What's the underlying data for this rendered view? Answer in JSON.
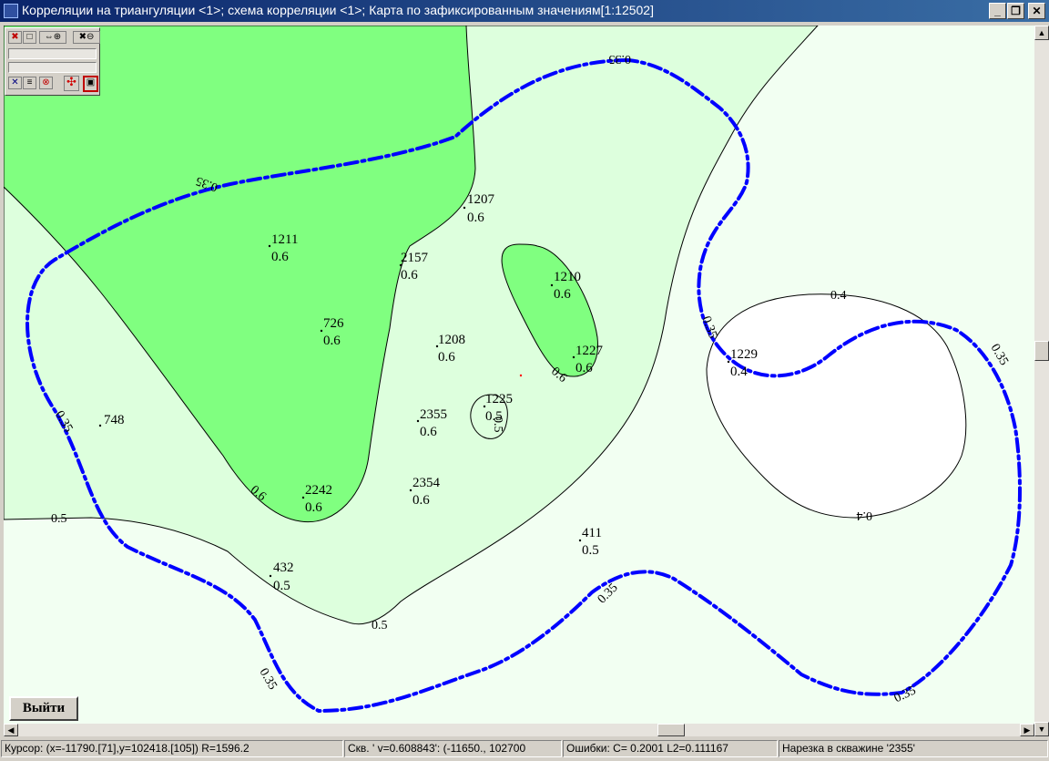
{
  "window": {
    "title": "Корреляции на триангуляции <1>; схема корреляции <1>; Карта по зафиксированным значениям[1:12502]",
    "buttons": {
      "minimize": "_",
      "restore": "❐",
      "close": "✕"
    }
  },
  "toolbox": {
    "row1": [
      "delete-icon",
      "square-icon",
      "move-zoom-icon",
      "zoom-out-icon"
    ],
    "row2": [
      "cross-icon",
      "list-icon",
      "stop-icon",
      "navigate-icon",
      "map-icon"
    ]
  },
  "map": {
    "colors": {
      "zone06": "#80ff80",
      "zone05": "#ddffdd",
      "zone04": "#ffffff",
      "background": "#f2fff2",
      "isoline": "#0000ff"
    },
    "wells": [
      {
        "id": "1207",
        "value": "0.6"
      },
      {
        "id": "1211",
        "value": "0.6"
      },
      {
        "id": "2157",
        "value": "0.6"
      },
      {
        "id": "1210",
        "value": "0.6"
      },
      {
        "id": "726",
        "value": "0.6"
      },
      {
        "id": "1208",
        "value": "0.6"
      },
      {
        "id": "1227",
        "value": "0.6"
      },
      {
        "id": "1229",
        "value": "0.4"
      },
      {
        "id": "1225",
        "value": "0.5"
      },
      {
        "id": "748",
        "value": ""
      },
      {
        "id": "2355",
        "value": "0.6"
      },
      {
        "id": "2242",
        "value": "0.6"
      },
      {
        "id": "2354",
        "value": "0.6"
      },
      {
        "id": "411",
        "value": "0.5"
      },
      {
        "id": "432",
        "value": "0.5"
      }
    ],
    "contour_labels": [
      "0.35",
      "0.35",
      "0.35",
      "0.35",
      "0.35",
      "0.35",
      "0.35",
      "0.35",
      "0.4",
      "0.4",
      "0.5",
      "0.5",
      "0.5",
      "0.6",
      "0.6"
    ]
  },
  "exit_button": "Выйти",
  "status": {
    "cursor": "Курсор: (x=-11790.[71],y=102418.[105]) R=1596.2",
    "well": "Скв. ' v=0.608843': (-11650., 102700",
    "errors": "Ошибки: C=  0.2001 L2=0.111167",
    "slice": "Нарезка в скважине '2355'"
  }
}
